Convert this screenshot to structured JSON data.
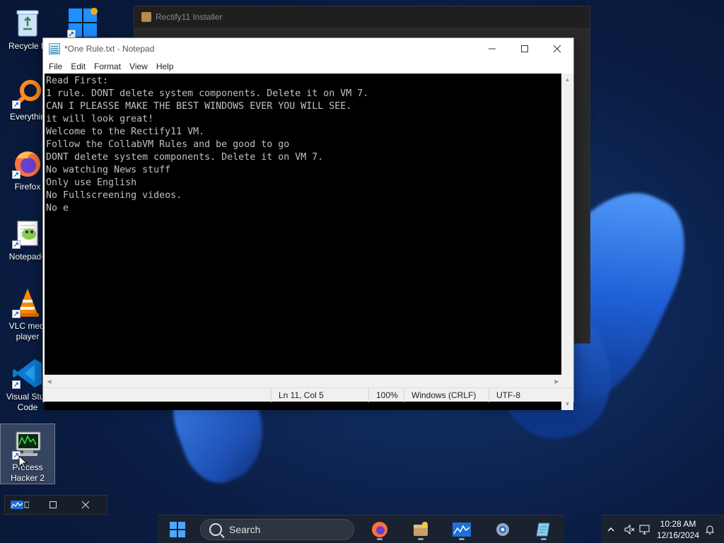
{
  "desktop": {
    "icons": [
      {
        "label": "Recycle B",
        "icon": "recycle-bin-icon"
      },
      {
        "label": "",
        "icon": "windows-icon"
      },
      {
        "label": "Everythin",
        "icon": "everything-search-icon"
      },
      {
        "label": "Firefox",
        "icon": "firefox-icon"
      },
      {
        "label": "Notepad+",
        "icon": "notepad-plus-plus-icon"
      },
      {
        "label": "VLC medi\nplayer",
        "icon": "vlc-icon"
      },
      {
        "label": "Visual Stud\nCode",
        "icon": "vscode-icon"
      },
      {
        "label": "Process\nHacker 2",
        "icon": "process-hacker-icon"
      }
    ]
  },
  "installer": {
    "title": "Rectify11 Installer"
  },
  "notepad": {
    "title": "*One Rule.txt - Notepad",
    "menu": [
      "File",
      "Edit",
      "Format",
      "View",
      "Help"
    ],
    "content": "Read First:\n1 rule. DONT delete system components. Delete it on VM 7.\nCAN I PLEASSE MAKE THE BEST WINDOWS EVER YOU WILL SEE.\nit will look great!\nWelcome to the Rectify11 VM.\nFollow the CollabVM Rules and be good to go\nDONT delete system components. Delete it on VM 7.\nNo watching News stuff\nOnly use English\nNo Fullscreening videos.\nNo e",
    "status": {
      "position": "Ln 11, Col 5",
      "zoom": "100%",
      "line_ending": "Windows (CRLF)",
      "encoding": "UTF-8"
    }
  },
  "taskbar": {
    "search_label": "Search",
    "apps": [
      "firefox-icon",
      "rectify11-installer-icon",
      "task-manager-icon",
      "settings-gear-icon",
      "notepad-icon"
    ],
    "clock_time": "10:28 AM",
    "clock_date": "12/16/2024"
  },
  "colors": {
    "wallpaper": "#0f2a5c",
    "taskbar": "#1c222e",
    "editor_bg": "#000000",
    "editor_fg": "#c0c0c0"
  }
}
